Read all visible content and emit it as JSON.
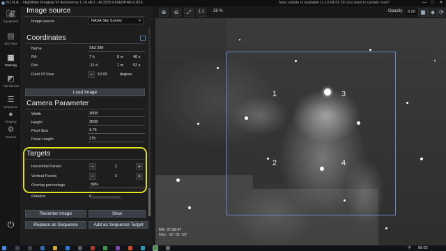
{
  "titlebar": {
    "title": "N.I.N.A. - Nighttime Imaging 'N' Astronomy 1.10 HF1  -  ACI533 618EDPHII-0.82X",
    "update_notice": "New update is available (1.10 HF2)! Do you want to update now?",
    "minimize": "—",
    "maximize": "□",
    "close": "✕"
  },
  "nav": {
    "items": [
      {
        "label": "Equipment",
        "icon": "camera-icon"
      },
      {
        "label": "Sky Atlas",
        "icon": "atlas-icon"
      },
      {
        "label": "Framing",
        "icon": "framing-icon",
        "active": true
      },
      {
        "label": "Flat Wizard",
        "icon": "flat-wizard-icon"
      },
      {
        "label": "Sequence",
        "icon": "sequence-icon"
      },
      {
        "label": "Imaging",
        "icon": "imaging-icon"
      },
      {
        "label": "Options",
        "icon": "gear-icon"
      }
    ],
    "power_icon": "power-icon"
  },
  "image_source": {
    "title": "Image source",
    "label": "Image source",
    "value": "NASA Sky Survey"
  },
  "coordinates": {
    "title": "Coordinates",
    "name_label": "Name",
    "name_value": "Sh2 296",
    "ra_label": "RA",
    "ra_h": "7 h",
    "ra_m": "6 m",
    "ra_s": "46 s",
    "dec_label": "Dec",
    "dec_d": "-11 d",
    "dec_m": "1 m",
    "dec_s": "52 s",
    "fov_label": "Field Of View",
    "fov_value": "10.00",
    "fov_unit": "degree",
    "load_button": "Load Image"
  },
  "camera": {
    "title": "Camera Parameter",
    "width_label": "Width",
    "width_value": "3008",
    "height_label": "Height",
    "height_value": "3008",
    "pixel_label": "Pixel Size",
    "pixel_value": "3.76",
    "focal_label": "Focal Length",
    "focal_value": "275"
  },
  "targets": {
    "title": "Targets",
    "h_panels_label": "Horizontal Panels",
    "h_panels_value": "2",
    "v_panels_label": "Vertical Panels",
    "v_panels_value": "2",
    "overlap_label": "Overlap percentage",
    "overlap_value": "30%",
    "rotation_label": "Rotation",
    "rotation_value": "0"
  },
  "actions": {
    "recenter": "Recenter Image",
    "slew": "Slew",
    "replace_sequence": "Replace as Sequence",
    "add_sequence": "Add as Sequence Target"
  },
  "viewer": {
    "zoom_level": "26 %",
    "one_to_one": "1:1",
    "opacity_label": "Opacity",
    "opacity_value": "0.20",
    "panel_labels": [
      "1",
      "2",
      "3",
      "4"
    ],
    "ra_readout": "RA: 07:06:47",
    "dec_readout": "Dec: -11° 01' 53\""
  },
  "taskbar": {
    "time": "06:02",
    "lang": "中"
  },
  "colors": {
    "accent": "#5b7fa6",
    "highlight": "#e2e21a",
    "fov_rect": "#6f86c9"
  }
}
